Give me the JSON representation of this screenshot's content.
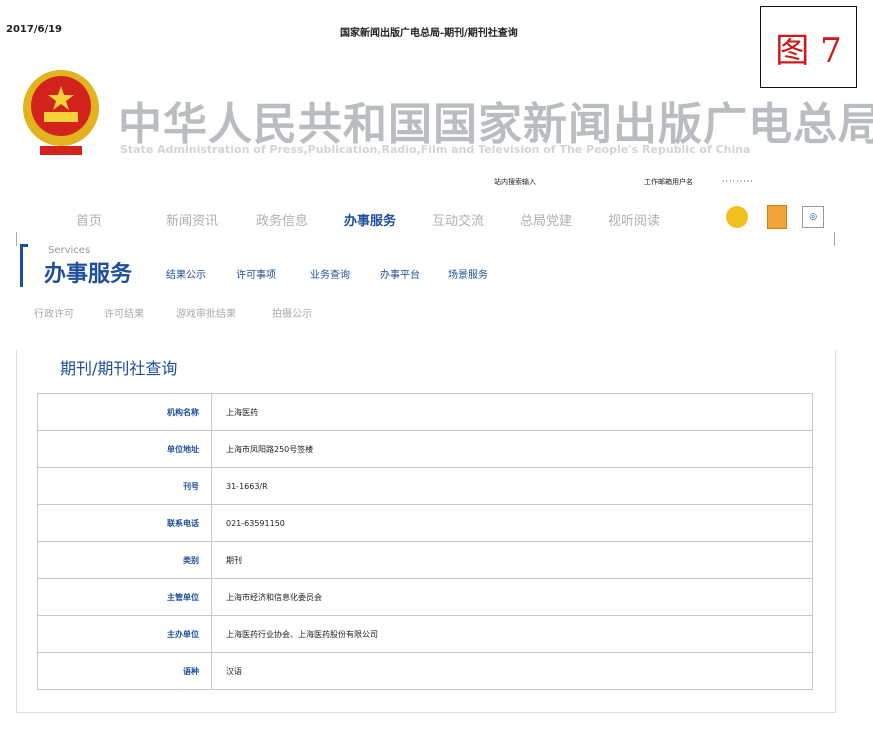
{
  "header": {
    "date": "2017/6/19",
    "page_title": "国家新闻出版广电总局-期刊/期刊社查询",
    "figure_label": "图 7",
    "site_title_cn": "中华人民共和国国家新闻出版广电总局",
    "site_title_en": "State Administration of Press,Publication,Radio,Film and Television of The People's Republic of China",
    "search_label": "站内搜索输入",
    "login_label": "工作邮箱用户名",
    "password_mask": "·········"
  },
  "nav": {
    "items": [
      "首页",
      "新闻资讯",
      "政务信息",
      "办事服务",
      "互动交流",
      "总局党建",
      "视听阅读"
    ],
    "active": "办事服务"
  },
  "services": {
    "en": "Services",
    "cn": "办事服务",
    "links": [
      "结果公示",
      "许可事项",
      "业务查询",
      "办事平台",
      "场景服务"
    ],
    "sub_links": [
      "行政许可",
      "许可结果",
      "游戏审批结果",
      "拍摄公示"
    ]
  },
  "query": {
    "title": "期刊/期刊社查询",
    "rows": [
      {
        "key": "机构名称",
        "value": "上海医药"
      },
      {
        "key": "单位地址",
        "value": "上海市凤阳路250号签楼"
      },
      {
        "key": "刊号",
        "value": "31-1663/R"
      },
      {
        "key": "联系电话",
        "value": "021-63591150"
      },
      {
        "key": "类别",
        "value": "期刊"
      },
      {
        "key": "主管单位",
        "value": "上海市经济和信息化委员会"
      },
      {
        "key": "主办单位",
        "value": "上海医药行业协会、上海医药股份有限公司"
      },
      {
        "key": "语种",
        "value": "汉语"
      }
    ]
  },
  "icons": {
    "emblem": "national-emblem-icon",
    "chat": "chat-icon",
    "document": "document-icon",
    "accessibility": "accessibility-icon"
  }
}
